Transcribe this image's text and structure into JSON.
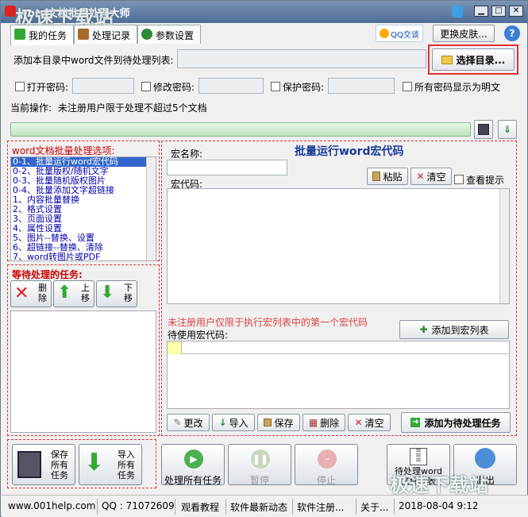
{
  "window": {
    "title": "word文档批量处理大师",
    "watermark": "极速下载站"
  },
  "tabs": [
    {
      "label": "我的任务"
    },
    {
      "label": "处理记录"
    },
    {
      "label": "参数设置"
    }
  ],
  "header": {
    "qq_label": "QQ交谈",
    "skin_label": "更换皮肤...",
    "help_label": "?"
  },
  "source": {
    "prompt": "添加本目录中word文件到待处理列表:",
    "path_value": "",
    "choose_dir_label": "选择目录..."
  },
  "passwords": {
    "open_label": "打开密码:",
    "modify_label": "修改密码:",
    "protect_label": "保护密码:",
    "show_plain_label": "所有密码显示为明文"
  },
  "current_op": {
    "label": "当前操作:",
    "text": "未注册用户限于处理不超过5个文档"
  },
  "progress": {
    "value": 0
  },
  "options": {
    "title": "word文档批量处理选项:",
    "items": [
      "0-1、批量运行word宏代码",
      "0-2、批量版权/随机文字",
      "0-3、批量随机版权图片",
      "0-4、批量添加文字超链接",
      "1、内容批量替换",
      "2、格式设置",
      "3、页面设置",
      "4、属性设置",
      "5、图片--替换、设置",
      "6、超链接--替换、清除",
      "7、word转图片或PDF"
    ]
  },
  "pending": {
    "title": "等待处理的任务:",
    "delete_label": "删\n除",
    "up_label": "上\n移",
    "down_label": "下\n移"
  },
  "macro": {
    "heading": "批量运行word宏代码",
    "name_label": "宏名称:",
    "name_value": "",
    "code_label": "宏代码:",
    "paste_label": "粘贴",
    "clear_label": "清空",
    "hint_label": "查看提示",
    "notice": "未注册用户仅限于执行宏列表中的第一个宏代码",
    "add_to_list_label": "添加到宏列表",
    "list_label": "待使用宏代码:",
    "tools": {
      "modify": "更改",
      "import": "导入",
      "save": "保存",
      "delete": "删除",
      "clear": "清空"
    },
    "add_task_label": "添加为待处理任务"
  },
  "bottom": {
    "save_tasks": "保存\n所有\n任务",
    "import_tasks": "导入\n所有\n任务",
    "process_all": "处理所有任务",
    "pause": "暂停",
    "stop": "停止",
    "pending_list": "待处理word\n文件列表",
    "exit": "退出"
  },
  "statusbar": {
    "website": "www.001help.com",
    "qq": "QQ : 71072609",
    "tutorial": "观看教程",
    "news": "软件最新动态",
    "register": "软件注册...",
    "about": "关于...",
    "datetime": "2018-08-04  9:12"
  }
}
